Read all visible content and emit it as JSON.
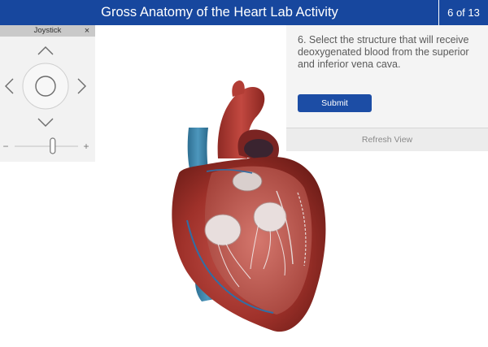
{
  "header": {
    "title": "Gross Anatomy of the Heart Lab Activity",
    "page_counter": "6 of 13"
  },
  "joystick": {
    "title": "Joystick",
    "close_glyph": "×",
    "minus_label": "−",
    "plus_label": "+",
    "zoom_level": 0.6
  },
  "question": {
    "text": "6. Select the structure that will receive deoxygenated blood from the superior and inferior vena cava.",
    "submit_label": "Submit",
    "refresh_label": "Refresh View"
  },
  "colors": {
    "header_bg": "#17479e",
    "submit_bg": "#1c4da5",
    "heart_muscle": "#a8362e",
    "vessel_blue": "#3f86ab"
  }
}
